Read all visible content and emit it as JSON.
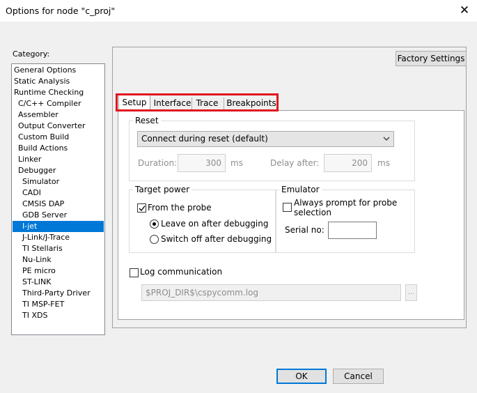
{
  "window": {
    "title": "Options for node \"c_proj\"",
    "close_glyph": "✕"
  },
  "category": {
    "label": "Category:",
    "items": [
      {
        "label": "General Options",
        "indent": 0
      },
      {
        "label": "Static Analysis",
        "indent": 0
      },
      {
        "label": "Runtime Checking",
        "indent": 0
      },
      {
        "label": "C/C++ Compiler",
        "indent": 1
      },
      {
        "label": "Assembler",
        "indent": 1
      },
      {
        "label": "Output Converter",
        "indent": 1
      },
      {
        "label": "Custom Build",
        "indent": 1
      },
      {
        "label": "Build Actions",
        "indent": 1
      },
      {
        "label": "Linker",
        "indent": 1
      },
      {
        "label": "Debugger",
        "indent": 1
      },
      {
        "label": "Simulator",
        "indent": 2
      },
      {
        "label": "CADI",
        "indent": 2
      },
      {
        "label": "CMSIS DAP",
        "indent": 2
      },
      {
        "label": "GDB Server",
        "indent": 2
      },
      {
        "label": "I-jet",
        "indent": 2,
        "selected": true
      },
      {
        "label": "J-Link/J-Trace",
        "indent": 2
      },
      {
        "label": "TI Stellaris",
        "indent": 2
      },
      {
        "label": "Nu-Link",
        "indent": 2
      },
      {
        "label": "PE micro",
        "indent": 2
      },
      {
        "label": "ST-LINK",
        "indent": 2
      },
      {
        "label": "Third-Party Driver",
        "indent": 2
      },
      {
        "label": "TI MSP-FET",
        "indent": 2
      },
      {
        "label": "TI XDS",
        "indent": 2
      }
    ]
  },
  "factory_settings_label": "Factory Settings",
  "tabs": [
    "Setup",
    "Interface",
    "Trace",
    "Breakpoints"
  ],
  "active_tab": "Setup",
  "reset": {
    "group_label": "Reset",
    "selected": "Connect during reset (default)",
    "duration_label": "Duration:",
    "duration_value": "300",
    "duration_unit": "ms",
    "delay_label": "Delay after:",
    "delay_value": "200",
    "delay_unit": "ms"
  },
  "target_power": {
    "group_label": "Target power",
    "from_probe_label": "From the probe",
    "from_probe_checked": true,
    "leave_on_label": "Leave on after debugging",
    "switch_off_label": "Switch off after debugging",
    "selected_option": "Leave on after debugging"
  },
  "emulator": {
    "group_label": "Emulator",
    "always_prompt_line1": "Always prompt for probe",
    "always_prompt_line2": "selection",
    "always_prompt_checked": false,
    "serial_label": "Serial no:",
    "serial_value": ""
  },
  "log": {
    "label": "Log communication",
    "checked": false,
    "path": "$PROJ_DIR$\\cspycomm.log",
    "browse_label": "..."
  },
  "footer": {
    "ok_label": "OK",
    "cancel_label": "Cancel"
  }
}
